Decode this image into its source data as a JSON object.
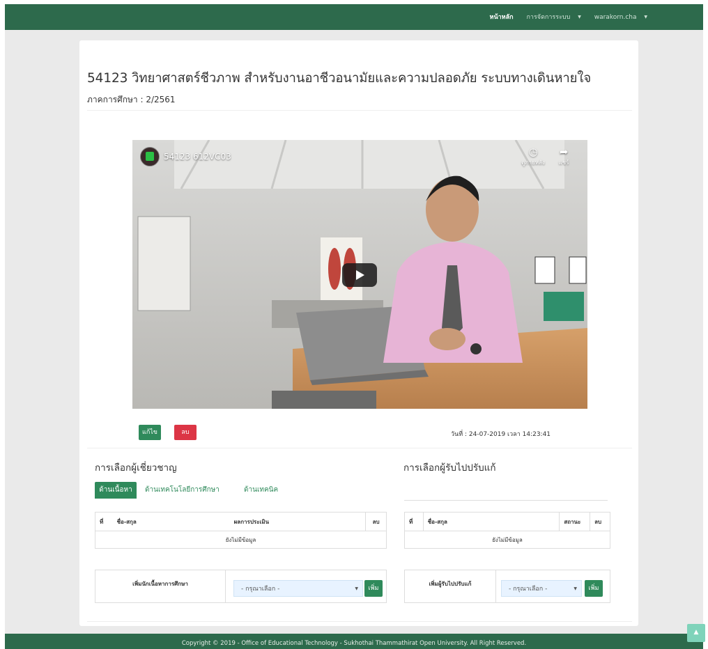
{
  "nav": {
    "home": "หน้าหลัก",
    "manage": "การจัดการระบบ",
    "user": "warakorn.cha"
  },
  "course": {
    "title": "54123 วิทยาศาสตร์ชีวภาพ สำหรับงานอาชีวอนามัยและความปลอดภัย ระบบทางเดินหายใจ",
    "term": "ภาคการศึกษา : 2/2561"
  },
  "video": {
    "title": "54123 612VC03",
    "watch_later": "ดูภายหลัง",
    "share": "แชร์"
  },
  "actions": {
    "edit": "แก้ไข",
    "delete": "ลบ",
    "date": "วันที่ : 24-07-2019 เวลา 14:23:41"
  },
  "experts": {
    "title": "การเลือกผู้เชี่ยวชาญ",
    "tabs": [
      "ด้านเนื้อหา",
      "ด้านเทคโนโลยีการศึกษา",
      "ด้านเทคนิค"
    ],
    "headers": [
      "ที่",
      "ชื่อ-สกุล",
      "ผลการประเมิน",
      "ลบ"
    ],
    "empty": "ยังไม่มีข้อมูล",
    "add_label": "เพิ่มนักเนื้อหาการศึกษา",
    "select_placeholder": "- กรุณาเลือก -",
    "add_button": "เพิ่ม"
  },
  "revisers": {
    "title": "การเลือกผู้รับไปปรับแก้",
    "headers": [
      "ที่",
      "ชื่อ-สกุล",
      "สถานะ",
      "ลบ"
    ],
    "empty": "ยังไม่มีข้อมูล",
    "add_label": "เพิ่มผู้รับไปปรับแก้",
    "select_placeholder": "- กรุณาเลือก -",
    "add_button": "เพิ่ม"
  },
  "footer": "Copyright © 2019 - Office of Educational Technology - Sukhothai Thammathirat Open University. All Right Reserved.",
  "colors": {
    "primary": "#2d6a4c",
    "accent": "#2f8a5b",
    "danger": "#dc3545",
    "select_bg": "#e8f3ff"
  },
  "icons": {
    "play": "play-icon",
    "clock": "clock-icon",
    "share": "share-icon",
    "caret": "caret-down-icon",
    "scroll_top": "chevron-up-icon"
  }
}
